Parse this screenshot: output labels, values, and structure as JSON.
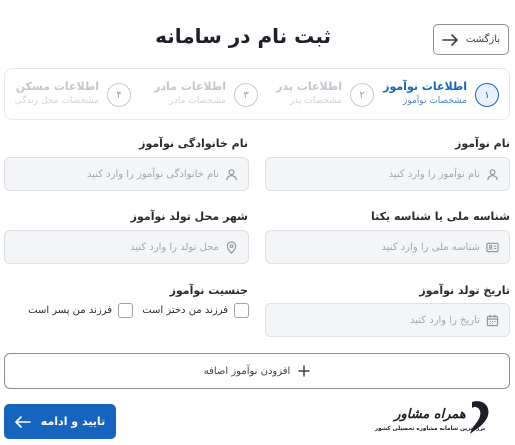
{
  "header": {
    "title": "ثبت نام در سامانه",
    "back_label": "بازگشت"
  },
  "steps": [
    {
      "num": "۱",
      "title": "اطلاعات نوآموز",
      "subtitle": "مشخصات نوآموز",
      "active": true
    },
    {
      "num": "۲",
      "title": "اطلاعات پدر",
      "subtitle": "مشخصات پدر",
      "active": false
    },
    {
      "num": "۳",
      "title": "اطلاعات مادر",
      "subtitle": "مشخصات مادر",
      "active": false
    },
    {
      "num": "۴",
      "title": "اطلاعات مسکن",
      "subtitle": "مشخصات محل زندگی",
      "active": false
    }
  ],
  "form": {
    "first_name": {
      "label": "نام نوآموز",
      "placeholder": "نام نوآموز را وارد کنید",
      "value": ""
    },
    "last_name": {
      "label": "نام خانوادگی نوآموز",
      "placeholder": "نام خانوادگی نوآموز را وارد کنید",
      "value": ""
    },
    "national_id": {
      "label": "شناسه ملی یا شناسه یکتا",
      "placeholder": "شناسه ملی را وارد کنید",
      "value": ""
    },
    "birth_city": {
      "label": "شهر محل تولد نوآموز",
      "placeholder": "محل تولد را وارد کنید",
      "value": ""
    },
    "birth_date": {
      "label": "تاریخ تولد نوآموز",
      "placeholder": "تاریخ را وارد کنید",
      "value": ""
    },
    "gender": {
      "label": "جنسیت نوآموز",
      "options": [
        "فرزند من دختر است",
        "فرزند من پسر است"
      ],
      "selected": null
    }
  },
  "actions": {
    "add_student": "افزودن نوآموز اضافه",
    "submit": "تایید و ادامه"
  },
  "logo": {
    "name": "همراه مشاور",
    "tagline": "بزرگترین سامانه مشاوره تحصیلی کشور"
  },
  "colors": {
    "accent": "#1565c0",
    "field_bg": "#f4f5f7",
    "border": "#dcdfe4"
  }
}
